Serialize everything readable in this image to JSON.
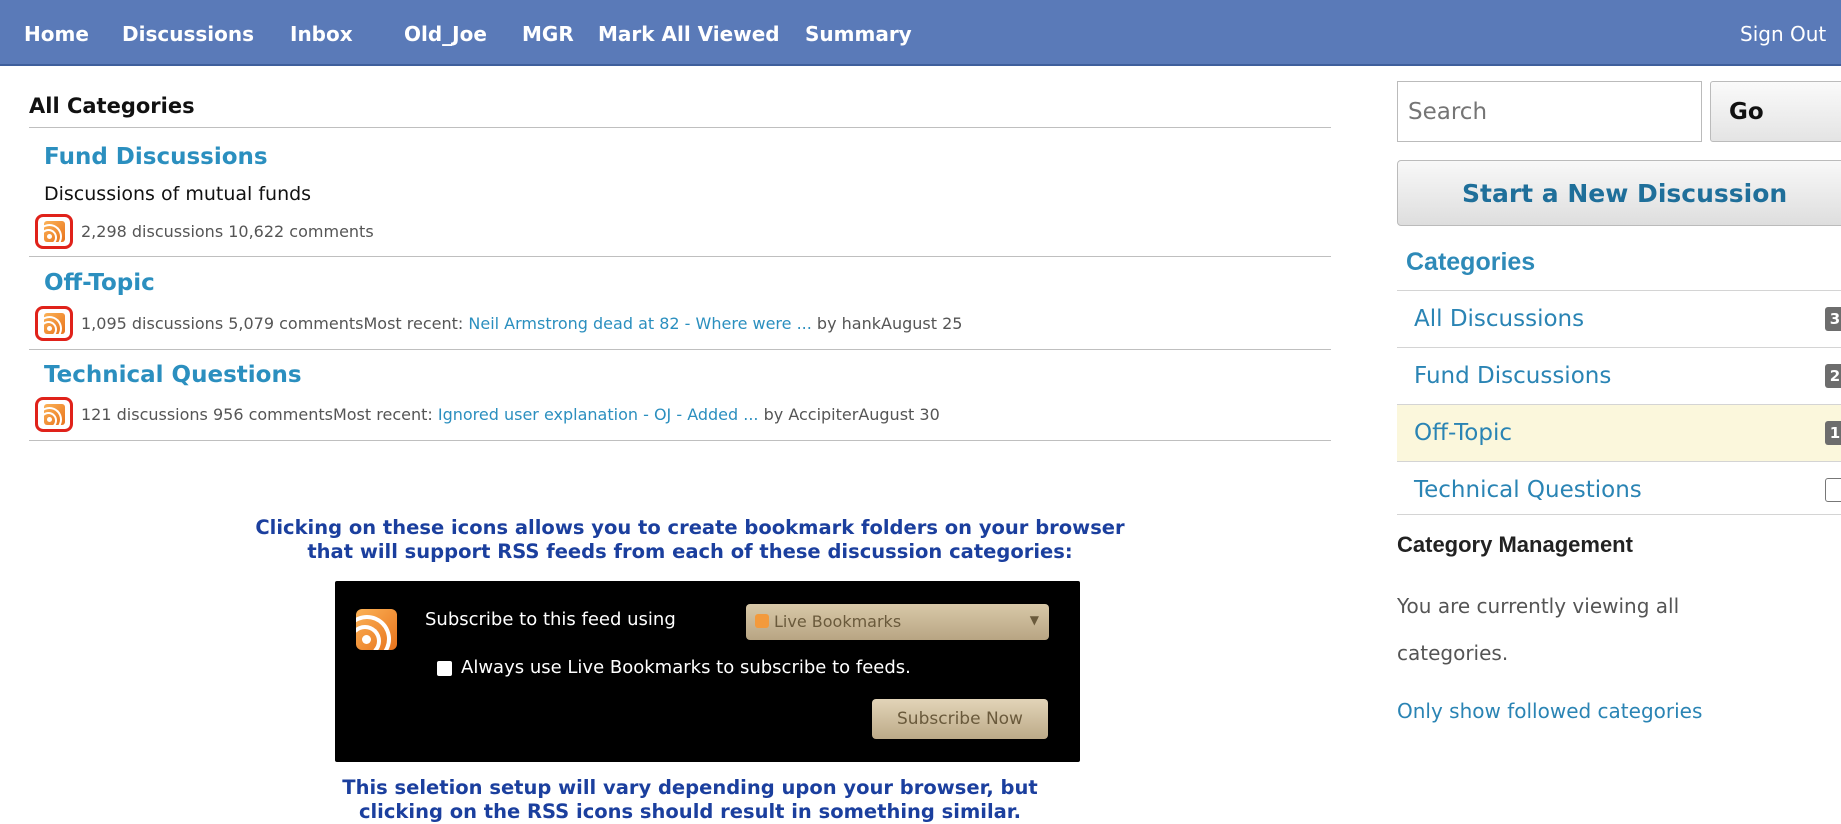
{
  "nav": {
    "home": "Home",
    "discussions": "Discussions",
    "inbox": "Inbox",
    "user": "Old_Joe",
    "mgr": "MGR",
    "mark_all_viewed": "Mark All Viewed",
    "summary": "Summary",
    "sign_out": "Sign Out"
  },
  "main": {
    "title": "All Categories",
    "categories": [
      {
        "name": "Fund Discussions",
        "description": "Discussions of mutual funds",
        "stats": "2,298 discussions 10,622 comments"
      },
      {
        "name": "Off-Topic",
        "stats": "1,095 discussions 5,079 comments",
        "recent_label": "Most recent:",
        "recent_link": "Neil Armstrong dead at 82 - Where were ...",
        "recent_by": " by hank",
        "recent_date": "August 25"
      },
      {
        "name": "Technical Questions",
        "stats": "121 discussions 956 comments",
        "recent_label": "Most recent:",
        "recent_link": "Ignored user explanation - OJ - Added ...",
        "recent_by": " by Accipiter",
        "recent_date": "August 30"
      }
    ]
  },
  "annotation": {
    "top_line1": "Clicking on these icons allows you to create bookmark folders on your browser",
    "top_line2": "that will support RSS feeds from each of these  discussion categories:",
    "bottom_line1": "This seletion setup will vary depending upon your browser, but",
    "bottom_line2": "clicking on the RSS icons should result in something similar."
  },
  "feed_dialog": {
    "subscribe_label": "Subscribe to this feed using",
    "selected_reader": "Live Bookmarks",
    "always_use": "Always use Live Bookmarks to subscribe to feeds.",
    "subscribe_button": "Subscribe Now"
  },
  "sidebar": {
    "search_placeholder": "Search",
    "go": "Go",
    "new_discussion": "Start a New Discussion",
    "categories_heading": "Categories",
    "items": [
      {
        "label": "All Discussions",
        "count": "3"
      },
      {
        "label": "Fund Discussions",
        "count": "2"
      },
      {
        "label": "Off-Topic",
        "count": "1"
      },
      {
        "label": "Technical Questions",
        "count": ""
      }
    ],
    "management_heading": "Category Management",
    "viewing_text": "You are currently viewing all categories.",
    "followed_link": "Only show followed categories"
  },
  "colors": {
    "topbar": "#5a7ab8",
    "link": "#2b8fbf",
    "annotation": "#1b3f9e",
    "rss": "#e8731c",
    "highlight_ring": "#e0221a",
    "active_row": "#fbf7dc"
  }
}
